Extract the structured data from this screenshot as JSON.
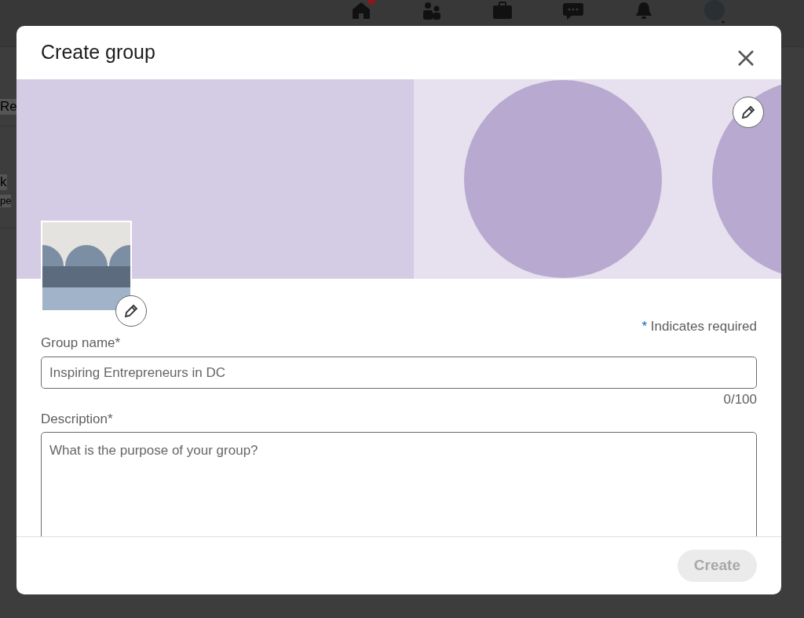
{
  "background": {
    "nav_icons": [
      {
        "kind": "home",
        "badge": true
      },
      {
        "kind": "people",
        "badge": false
      },
      {
        "kind": "briefcase",
        "badge": false
      },
      {
        "kind": "chat",
        "badge": false
      },
      {
        "kind": "bell",
        "badge": false
      },
      {
        "kind": "avatar",
        "badge": false
      }
    ],
    "texts": [
      "Re",
      "k",
      "pe"
    ]
  },
  "modal": {
    "title": "Create group",
    "required_note": {
      "mark": "*",
      "text": "Indicates required"
    },
    "group_name": {
      "label": "Group name*",
      "placeholder": "Inspiring Entrepreneurs in DC",
      "counter": "0/100"
    },
    "description": {
      "label": "Description*",
      "placeholder": "What is the purpose of your group?"
    },
    "create_button": {
      "label": "Create",
      "disabled": true
    }
  }
}
